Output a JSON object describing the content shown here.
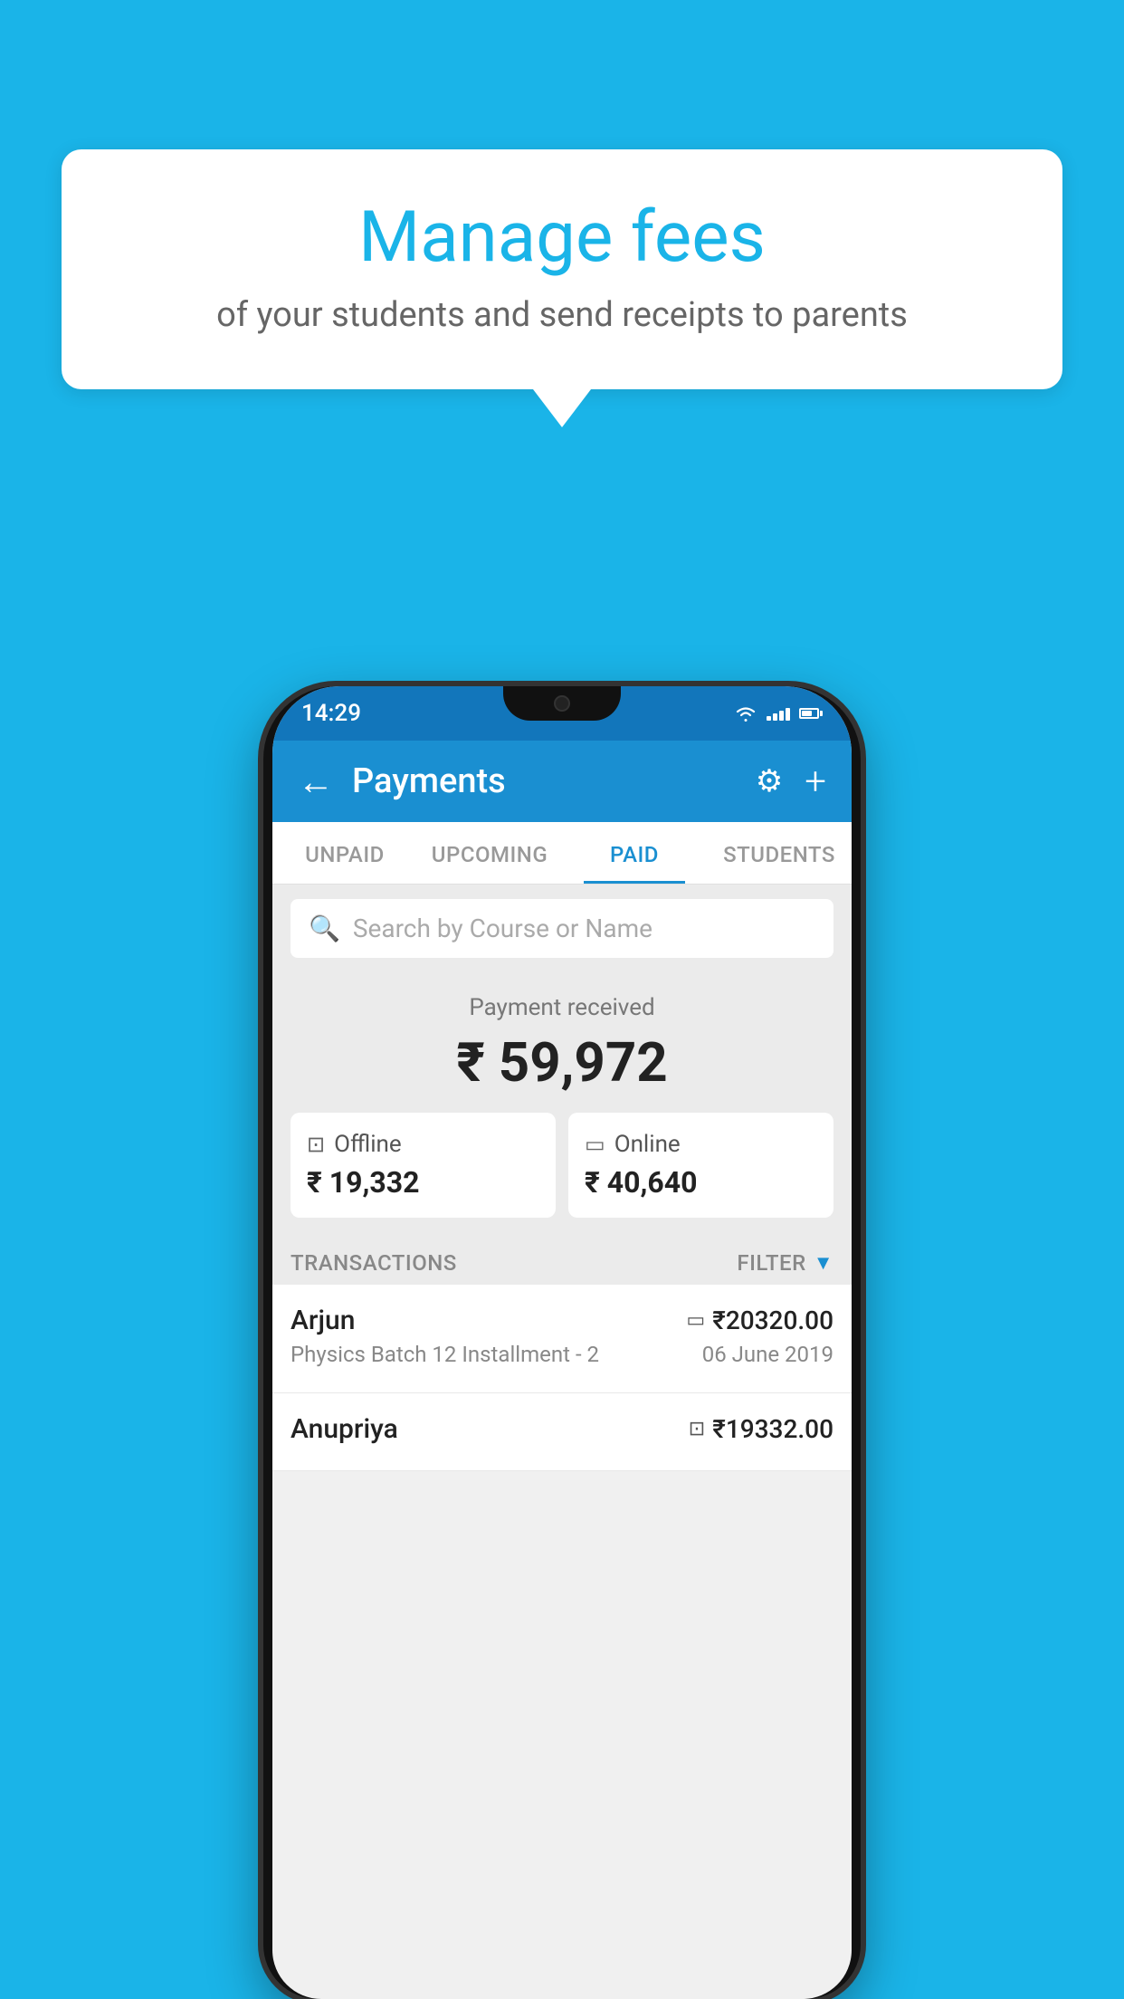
{
  "page": {
    "background_color": "#1ab4e8"
  },
  "tooltip": {
    "title": "Manage fees",
    "subtitle": "of your students and send receipts to parents"
  },
  "status_bar": {
    "time": "14:29"
  },
  "app_header": {
    "title": "Payments",
    "back_label": "←",
    "settings_label": "⚙",
    "add_label": "+"
  },
  "tabs": [
    {
      "id": "unpaid",
      "label": "UNPAID",
      "active": false
    },
    {
      "id": "upcoming",
      "label": "UPCOMING",
      "active": false
    },
    {
      "id": "paid",
      "label": "PAID",
      "active": true
    },
    {
      "id": "students",
      "label": "STUDENTS",
      "active": false
    }
  ],
  "search": {
    "placeholder": "Search by Course or Name"
  },
  "payment_summary": {
    "label": "Payment received",
    "amount": "₹ 59,972",
    "offline_label": "Offline",
    "offline_amount": "₹ 19,332",
    "online_label": "Online",
    "online_amount": "₹ 40,640"
  },
  "transactions": {
    "section_label": "TRANSACTIONS",
    "filter_label": "FILTER",
    "items": [
      {
        "name": "Arjun",
        "course": "Physics Batch 12 Installment - 2",
        "amount": "₹20320.00",
        "date": "06 June 2019",
        "type": "online"
      },
      {
        "name": "Anupriya",
        "course": "",
        "amount": "₹19332.00",
        "date": "",
        "type": "offline"
      }
    ]
  }
}
